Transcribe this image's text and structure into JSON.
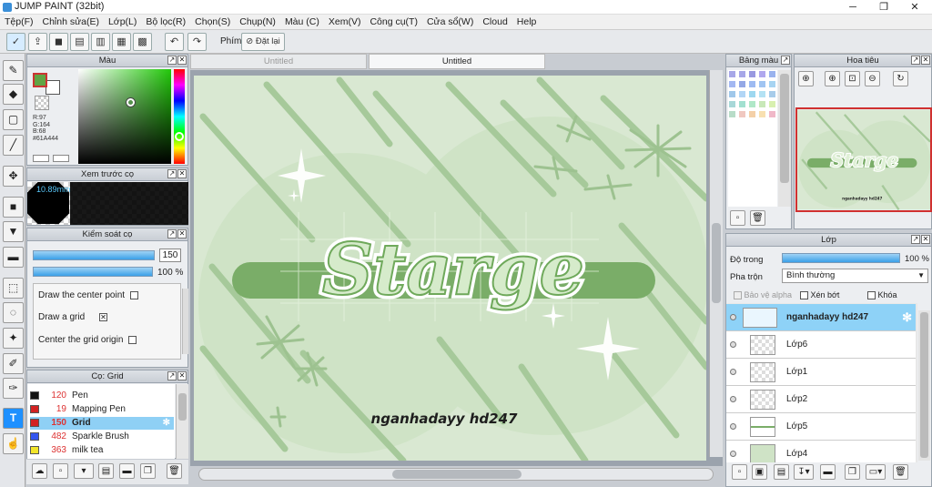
{
  "app": {
    "title": "JUMP PAINT (32bit)"
  },
  "window_buttons": [
    "─",
    "❐",
    "✕"
  ],
  "menu": [
    "Tệp(F)",
    "Chỉnh sửa(E)",
    "Lớp(L)",
    "Bộ lọc(R)",
    "Chọn(S)",
    "Chụp(N)",
    "Màu (C)",
    "Xem(V)",
    "Công cụ(T)",
    "Cửa sổ(W)",
    "Cloud",
    "Help"
  ],
  "toolbar": {
    "shortcut_label": "Phím",
    "reset_label": "Đặt lại"
  },
  "tabs": [
    {
      "label": "Untitled"
    },
    {
      "label": "Untitled"
    }
  ],
  "color_panel": {
    "title": "Màu",
    "r": "R:97",
    "g": "G:164",
    "b": "B:68",
    "hex": "#61A444",
    "current_color": "#61a444"
  },
  "brush_preview": {
    "title": "Xem trước cọ",
    "size_label": "10.89mm"
  },
  "brush_control": {
    "title": "Kiểm soát cọ",
    "size_value": "150",
    "opacity_value": "100 %",
    "size_fraction": 1.0,
    "opacity_fraction": 1.0,
    "options": [
      {
        "label": "Draw the center point",
        "mark": ""
      },
      {
        "label": "Draw a grid",
        "mark": "✕"
      },
      {
        "label": "Center the grid origin",
        "mark": ""
      }
    ]
  },
  "brush_list": {
    "title": "Cọ: Grid",
    "items": [
      {
        "size": "120",
        "name": "Pen",
        "color": "#111111"
      },
      {
        "size": "19",
        "name": "Mapping Pen",
        "color": "#d22222"
      },
      {
        "size": "150",
        "name": "Grid",
        "color": "#d22222",
        "selected": true
      },
      {
        "size": "482",
        "name": "Sparkle Brush",
        "color": "#3355ee"
      },
      {
        "size": "363",
        "name": "milk tea",
        "color": "#f2e52a"
      }
    ]
  },
  "canvas": {
    "title_text": "Starge",
    "credit_text": "nganhadayy hd247",
    "bg": "#d9e8d2",
    "accent": "#7aad68"
  },
  "palette_panel": {
    "title": "Bảng màu",
    "colors": [
      "#a7a7e8",
      "#a7a7e8",
      "#9999e0",
      "#b0a8ee",
      "#9ab3ee",
      "#a3b8f2",
      "#94a8e6",
      "#9ebbf2",
      "#a1c5f2",
      "#a7d4f2",
      "#a0c8ea",
      "#b2d6f6",
      "#9ed8f0",
      "#b4e2f4",
      "#a8ccea",
      "#a8d8d8",
      "#a2e0d0",
      "#b0e8c8",
      "#c8e8b8",
      "#d8f0b0",
      "#b8dcc8",
      "#f0c8c0",
      "#f4d0a8",
      "#f8e0b0",
      "#f0b8c8"
    ]
  },
  "navigator": {
    "title": "Hoa tiêu"
  },
  "layer_panel": {
    "title": "Lớp",
    "opacity_label": "Độ trong",
    "opacity_value": "100 %",
    "opacity_fraction": 1.0,
    "blend_label": "Pha trộn",
    "blend_value": "Bình thường",
    "protect_alpha": "Bảo vệ alpha",
    "clipping": "Xén bớt",
    "lock": "Khóa",
    "layers": [
      {
        "name": "nganhadayy hd247",
        "selected": true
      },
      {
        "name": "Lớp6"
      },
      {
        "name": "Lớp1"
      },
      {
        "name": "Lớp2"
      },
      {
        "name": "Lớp5"
      },
      {
        "name": "Lớp4"
      }
    ]
  }
}
